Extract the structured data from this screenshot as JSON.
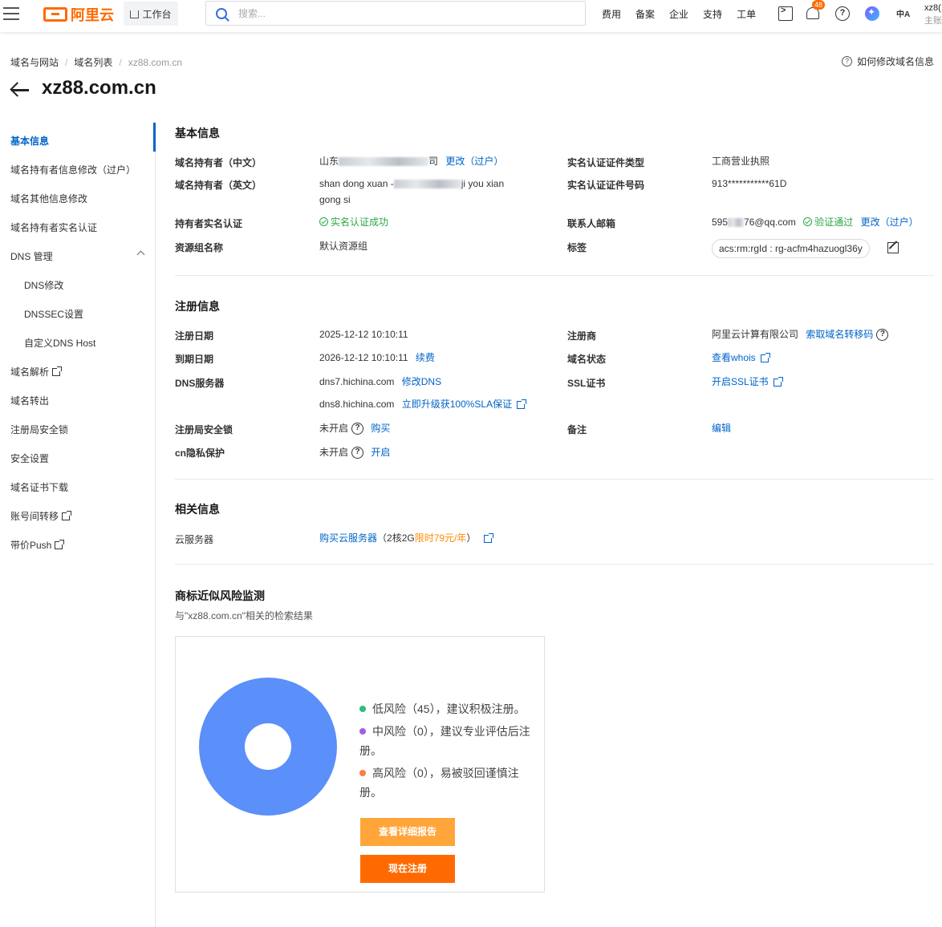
{
  "topbar": {
    "logo_text": "阿里云",
    "workbench": "工作台",
    "search_placeholder": "搜索...",
    "nav": [
      "费用",
      "备案",
      "企业",
      "支持",
      "工单"
    ],
    "notification_count": "48",
    "lang_icon_text": "中A",
    "user_name": "xz8(",
    "user_role": "主账"
  },
  "breadcrumb": [
    "域名与网站",
    "域名列表",
    "xz88.com.cn"
  ],
  "help_link": "如何修改域名信息",
  "page_title": "xz88.com.cn",
  "sidebar": {
    "items": [
      {
        "label": "基本信息",
        "active": true
      },
      {
        "label": "域名持有者信息修改（过户）"
      },
      {
        "label": "域名其他信息修改"
      },
      {
        "label": "域名持有者实名认证"
      },
      {
        "label": "DNS 管理"
      },
      {
        "label": "DNS修改",
        "sub": true
      },
      {
        "label": "DNSSEC设置",
        "sub": true
      },
      {
        "label": "自定义DNS Host",
        "sub": true
      },
      {
        "label": "域名解析",
        "external": true
      },
      {
        "label": "域名转出"
      },
      {
        "label": "注册局安全锁"
      },
      {
        "label": "安全设置"
      },
      {
        "label": "域名证书下载"
      },
      {
        "label": "账号间转移",
        "external": true
      },
      {
        "label": "带价Push",
        "external": true
      }
    ]
  },
  "basic": {
    "title": "基本信息",
    "owner_cn_label": "域名持有者（中文）",
    "owner_cn_value_prefix": "山东",
    "owner_cn_value_suffix": "司",
    "owner_cn_link": "更改（过户）",
    "owner_en_label": "域名持有者（英文）",
    "owner_en_value_a": "shan dong xuan -",
    "owner_en_value_b": "ji you xian",
    "owner_en_value_c": "gong si",
    "realname_label": "持有者实名认证",
    "realname_value": "实名认证成功",
    "resource_group_label": "资源组名称",
    "resource_group_value": "默认资源组",
    "cert_type_label": "实名认证证件类型",
    "cert_type_value": "工商营业执照",
    "cert_no_label": "实名认证证件号码",
    "cert_no_value": "913***********61D",
    "email_label": "联系人邮箱",
    "email_prefix": "595",
    "email_suffix": "76@qq.com",
    "email_status": "验证通过",
    "email_link": "更改（过户）",
    "tag_label": "标签",
    "tag_value": "acs:rm:rgId : rg-acfm4hazuogl36y"
  },
  "registration": {
    "title": "注册信息",
    "reg_date_label": "注册日期",
    "reg_date_value": "2025-12-12 10:10:11",
    "expire_label": "到期日期",
    "expire_value": "2026-12-12 10:10:11",
    "renew_link": "续费",
    "dns_label": "DNS服务器",
    "dns1": "dns7.hichina.com",
    "dns_modify_link": "修改DNS",
    "dns2": "dns8.hichina.com",
    "sla_link": "立即升级获100%SLA保证",
    "lock_label": "注册局安全锁",
    "lock_value": "未开启",
    "lock_link": "购买",
    "privacy_label": "cn隐私保护",
    "privacy_value": "未开启",
    "privacy_link": "开启",
    "registrar_label": "注册商",
    "registrar_value": "阿里云计算有限公司",
    "transfer_code_link": "索取域名转移码",
    "status_label": "域名状态",
    "whois_link": "查看whois",
    "ssl_label": "SSL证书",
    "ssl_link": "开启SSL证书",
    "remark_label": "备注",
    "remark_link": "编辑"
  },
  "related": {
    "title": "相关信息",
    "server_label": "云服务器",
    "server_link": "购买云服务器",
    "server_note_a": "（2核2G",
    "server_note_b": "限时79元/年",
    "server_note_c": "）"
  },
  "trademark": {
    "title": "商标近似风险监测",
    "subtitle": "与\"xz88.com.cn\"相关的检索结果",
    "low": {
      "label": "低风险（45），建议积极注册。",
      "color": "#2bbf77",
      "count": 45
    },
    "mid": {
      "label": "中风险（0），建议专业评估后注册。",
      "color": "#a45de5",
      "count": 0
    },
    "high": {
      "label": "高风险（0），易被驳回谨慎注册。",
      "color": "#ff7a45",
      "count": 0
    },
    "donut_color": "#5b8ff9",
    "report_button": "查看详细报告",
    "register_button": "现在注册"
  }
}
